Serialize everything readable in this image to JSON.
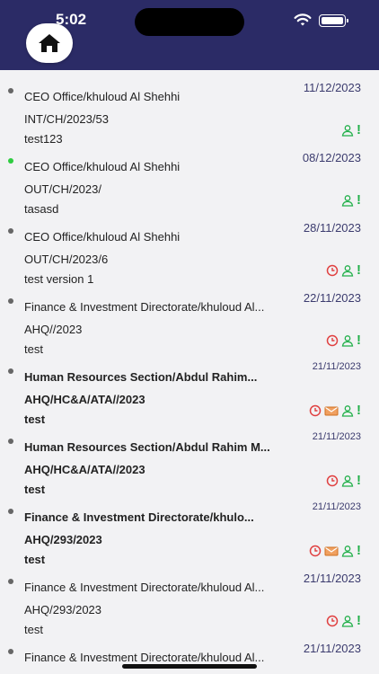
{
  "status_bar": {
    "time": "5:02"
  },
  "header": {
    "home_icon": "home-icon"
  },
  "colors": {
    "header_bg": "#2b2b66",
    "date_color": "#3b3b6e",
    "unread_dot": "#2ecc40",
    "alert_red": "#e04040",
    "status_green": "#22b04a"
  },
  "letters": [
    {
      "from": "CEO Office/khuloud Al Shehhi",
      "ref": "INT/CH/2023/53",
      "subject": "test123",
      "date": "11/12/2023",
      "bold": false,
      "unread": false,
      "icons": [
        "person-icon",
        "exclamation-icon"
      ]
    },
    {
      "from": "CEO Office/khuloud Al Shehhi",
      "ref": "OUT/CH/2023/",
      "subject": "tasasd",
      "date": "08/12/2023",
      "bold": false,
      "unread": true,
      "icons": [
        "person-icon",
        "exclamation-icon"
      ]
    },
    {
      "from": "CEO Office/khuloud Al Shehhi",
      "ref": "OUT/CH/2023/6",
      "subject": "test version 1",
      "date": "28/11/2023",
      "bold": false,
      "unread": false,
      "icons": [
        "clock-icon",
        "person-icon",
        "exclamation-icon"
      ]
    },
    {
      "from": "Finance & Investment Directorate/khuloud Al...",
      "ref": "AHQ//2023",
      "subject": "test",
      "date": "22/11/2023",
      "bold": false,
      "unread": false,
      "icons": [
        "clock-icon",
        "person-icon",
        "exclamation-icon"
      ]
    },
    {
      "from": "Human Resources Section/Abdul Rahim...",
      "ref": "AHQ/HC&A/ATA//2023",
      "subject": "test",
      "date": "21/11/2023",
      "bold": true,
      "unread": false,
      "icons": [
        "clock-icon",
        "envelope-icon",
        "person-icon",
        "exclamation-icon"
      ]
    },
    {
      "from": "Human Resources Section/Abdul Rahim M...",
      "ref": "AHQ/HC&A/ATA//2023",
      "subject": "test",
      "date": "21/11/2023",
      "bold": true,
      "unread": false,
      "icons": [
        "clock-icon",
        "person-icon",
        "exclamation-icon"
      ]
    },
    {
      "from": "Finance & Investment Directorate/khulo...",
      "ref": "AHQ/293/2023",
      "subject": "test",
      "date": "21/11/2023",
      "bold": true,
      "unread": false,
      "icons": [
        "clock-icon",
        "envelope-icon",
        "person-icon",
        "exclamation-icon"
      ]
    },
    {
      "from": "Finance & Investment Directorate/khuloud Al...",
      "ref": "AHQ/293/2023",
      "subject": "test",
      "date": "21/11/2023",
      "bold": false,
      "unread": false,
      "icons": [
        "clock-icon",
        "person-icon",
        "exclamation-icon"
      ]
    },
    {
      "from": "Finance & Investment Directorate/khuloud Al...",
      "ref": "",
      "subject": "",
      "date": "21/11/2023",
      "bold": false,
      "unread": false,
      "icons": []
    }
  ]
}
